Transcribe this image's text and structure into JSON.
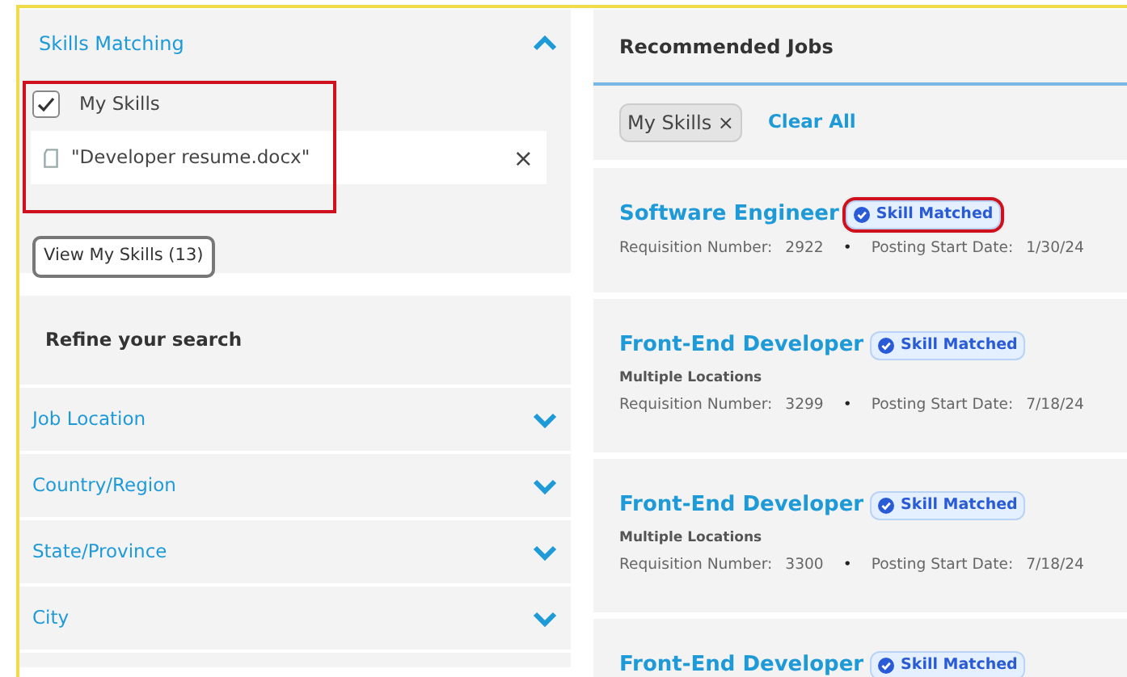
{
  "skills_matching": {
    "title": "Skills Matching",
    "expanded": true,
    "highlighted": true,
    "my_skills": {
      "label": "My Skills",
      "checked": true
    },
    "file": {
      "name": "\"Developer resume.docx\"",
      "remove": "×"
    },
    "view_button": "View My Skills (13)"
  },
  "refine": {
    "title": "Refine your search",
    "filters": [
      {
        "label": "Job Location",
        "expanded": false
      },
      {
        "label": "Country/Region",
        "expanded": false
      },
      {
        "label": "State/Province",
        "expanded": false
      },
      {
        "label": "City",
        "expanded": false
      }
    ]
  },
  "recommended": {
    "title": "Recommended Jobs",
    "chips": [
      {
        "label": "My Skills",
        "remove": "×"
      }
    ],
    "clear_all": "Clear All",
    "jobs": [
      {
        "title": "Software Engineer",
        "badge": "Skill Matched",
        "highlighted": true,
        "req_label": "Requisition Number:",
        "req_number": "2922",
        "separator": "•",
        "date_label": "Posting Start Date:",
        "date": "1/30/24"
      },
      {
        "title": "Front-End Developer",
        "badge": "Skill Matched",
        "highlighted": false,
        "location": "Multiple Locations",
        "req_label": "Requisition Number:",
        "req_number": "3299",
        "separator": "•",
        "date_label": "Posting Start Date:",
        "date": "7/18/24"
      },
      {
        "title": "Front-End Developer",
        "badge": "Skill Matched",
        "highlighted": false,
        "location": "Multiple Locations",
        "req_label": "Requisition Number:",
        "req_number": "3300",
        "separator": "•",
        "date_label": "Posting Start Date:",
        "date": "7/18/24"
      },
      {
        "title": "Front-End Developer",
        "badge": "Skill Matched",
        "highlighted": false
      }
    ]
  }
}
